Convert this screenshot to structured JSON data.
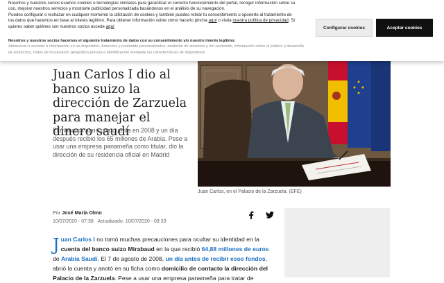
{
  "cookie": {
    "p1": "Nosotros y nuestros socios usamos cookies o tecnologías similares para garantizar el correcto funcionamiento del portal, recoger información sobre su uso, mejorar nuestros servicios y mostrarle publicidad personalizada basándonos en el análisis de su navegación.",
    "p2_a": "Puedes configurar o rechazar en cualquier momento la utilización de cookies y también puedes retirar tu consentimiento u oponerte al tratamiento de tus datos que hacemos en base al interés legítimo. Para obtener información sobre cómo hacerlo pincha",
    "p2_link1": "aquí",
    "p2_b": "o visita",
    "p2_link2": "nuestra política de privacidad",
    "p2_c": "Si quieres saber quiénes son nuestros socios accede",
    "p2_link3": "aquí",
    "sub_heading": "Nosotros y nuestros socios hacemos el siguiente tratamiento de datos con su consentimiento y/o nuestro interés legítimo:",
    "sub_list": "Almacenar o acceder a información en un dispositivo, Anuncios y contenido personalizados, medición de anuncios y del contenido, información sobre el público y desarrollo de productos, Datos de localización geográfica precisa e identificación mediante las características de dispositivos",
    "configure_label": "Configurar cookies",
    "accept_label": "Aceptar cookies"
  },
  "article": {
    "title": "Juan Carlos I dio al banco suizo la dirección de Zarzuela para manejar el dinero saudí",
    "lead": "El monarca abrió una cuenta en 2008 y un día después recibió los 65 millones de Arabia. Pese a usar una empresa panameña como titular, dio la dirección de su residencia oficial en Madrid",
    "caption": "Juan Carlos, en el Palacio de la Zarzuela. (EFE)",
    "byline_prefix": "Por",
    "author": "José María Olmo",
    "published": "10/07/2020 - 07:38",
    "updated": "Actualizado: 10/07/2020 - 09:33",
    "body": {
      "dropcap": "J",
      "link_name": "uan Carlos I",
      "t1": " no tomó muchas precauciones para ocultar su identidad en la ",
      "b1": "cuenta del banco suizo Mirabaud",
      "t2": " en la que recibió ",
      "link_amount": "64,88 millones de euros",
      "t3": " de ",
      "link_country": "Arabia Saudí",
      "t4": ". El 7 de agosto de 2008, ",
      "link_day": "un día antes de recibir esos fondos",
      "t5": ", abrió la cuenta y anotó en su ficha como ",
      "b2": "domicilio de contacto la dirección del Palacio de la Zarzuela",
      "t6": ". Pese a usar una empresa panameña para tratar de"
    }
  },
  "share": {
    "facebook_icon": "facebook-icon",
    "twitter_icon": "twitter-icon"
  },
  "colors": {
    "accent": "#1a6fbf",
    "accept_bg": "#111111"
  }
}
